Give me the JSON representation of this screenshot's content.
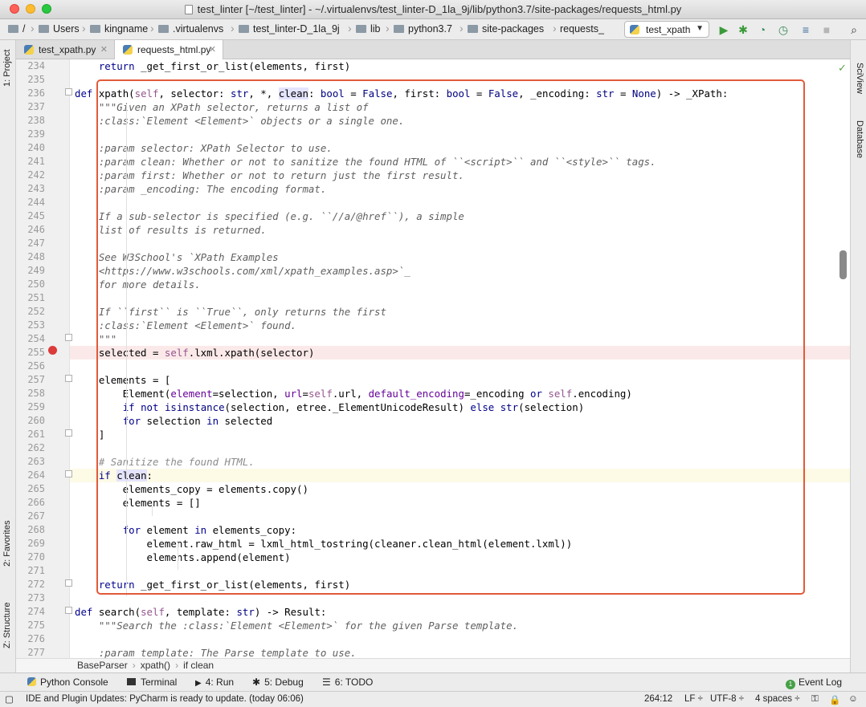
{
  "window": {
    "title": "test_linter [~/test_linter] - ~/.virtualenvs/test_linter-D_1la_9j/lib/python3.7/site-packages/requests_html.py"
  },
  "navbar": {
    "crumbs": [
      "/",
      "Users",
      "kingname",
      ".virtualenvs",
      "test_linter-D_1la_9j",
      "lib",
      "python3.7",
      "site-packages",
      "requests_"
    ],
    "run_config": "test_xpath"
  },
  "side": {
    "left_top": "1: Project",
    "left_fav": "2: Favorites",
    "left_struct": "Z: Structure",
    "right_top": "SciView",
    "right_db": "Database"
  },
  "tabs": [
    {
      "label": "test_xpath.py"
    },
    {
      "label": "requests_html.py"
    }
  ],
  "line_numbers": [
    "234",
    "235",
    "236",
    "237",
    "238",
    "239",
    "240",
    "241",
    "242",
    "243",
    "244",
    "245",
    "246",
    "247",
    "248",
    "249",
    "250",
    "251",
    "252",
    "253",
    "254",
    "255",
    "256",
    "257",
    "258",
    "259",
    "260",
    "261",
    "262",
    "263",
    "264",
    "265",
    "266",
    "267",
    "268",
    "269",
    "270",
    "271",
    "272",
    "273",
    "274",
    "275",
    "276",
    "277"
  ],
  "code": [
    "    return _get_first_or_list(elements, first)",
    "",
    "def xpath(self, selector: str, *, clean: bool = False, first: bool = False, _encoding: str = None) -> _XPath:",
    "    \"\"\"Given an XPath selector, returns a list of",
    "    :class:`Element <Element>` objects or a single one.",
    "",
    "    :param selector: XPath Selector to use.",
    "    :param clean: Whether or not to sanitize the found HTML of ``<script>`` and ``<style>`` tags.",
    "    :param first: Whether or not to return just the first result.",
    "    :param _encoding: The encoding format.",
    "",
    "    If a sub-selector is specified (e.g. ``//a/@href``), a simple",
    "    list of results is returned.",
    "",
    "    See W3School's `XPath Examples",
    "    <https://www.w3schools.com/xml/xpath_examples.asp>`_",
    "    for more details.",
    "",
    "    If ``first`` is ``True``, only returns the first",
    "    :class:`Element <Element>` found.",
    "    \"\"\"",
    "    selected = self.lxml.xpath(selector)",
    "",
    "    elements = [",
    "        Element(element=selection, url=self.url, default_encoding=_encoding or self.encoding)",
    "        if not isinstance(selection, etree._ElementUnicodeResult) else str(selection)",
    "        for selection in selected",
    "    ]",
    "",
    "    # Sanitize the found HTML.",
    "    if clean:",
    "        elements_copy = elements.copy()",
    "        elements = []",
    "",
    "        for element in elements_copy:",
    "            element.raw_html = lxml_html_tostring(cleaner.clean_html(element.lxml))",
    "            elements.append(element)",
    "",
    "    return _get_first_or_list(elements, first)",
    "",
    "def search(self, template: str) -> Result:",
    "    \"\"\"Search the :class:`Element <Element>` for the given Parse template.",
    "",
    "    :param template: The Parse template to use."
  ],
  "breadcrumb": {
    "items": [
      "BaseParser",
      "xpath()",
      "if clean"
    ]
  },
  "toolwindows": [
    "Python Console",
    "Terminal",
    "4: Run",
    "5: Debug",
    "6: TODO",
    "Event Log"
  ],
  "status": {
    "message": "IDE and Plugin Updates: PyCharm is ready to update. (today 06:06)",
    "position": "264:12",
    "line_sep": "LF",
    "encoding": "UTF-8",
    "indent": "4 spaces"
  },
  "colors": {
    "keyword": "#00008b",
    "self": "#94558d",
    "docstring": "#606060",
    "breakpoint": "#db3b3b",
    "highlight_box": "#e25a3a"
  }
}
